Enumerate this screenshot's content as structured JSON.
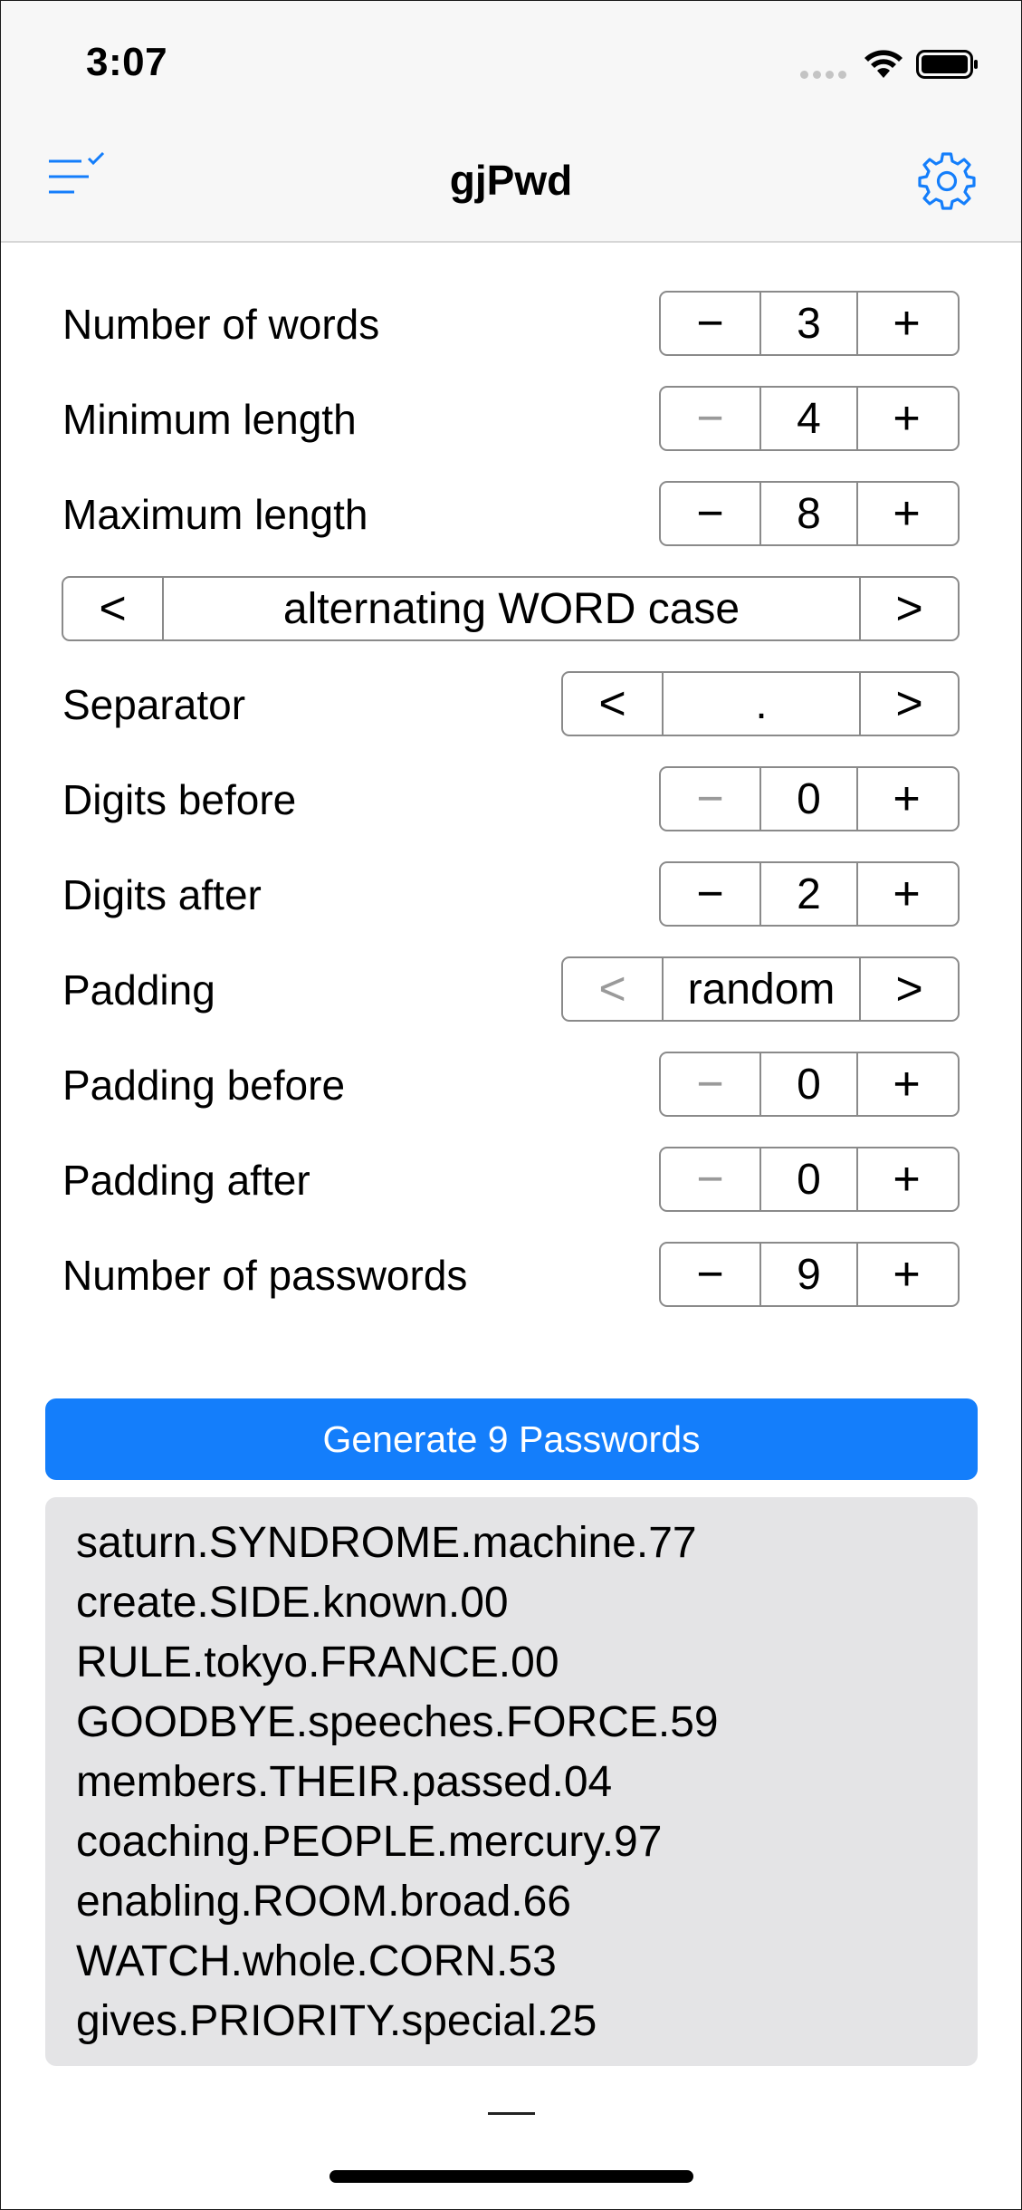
{
  "status_bar": {
    "time": "3:07"
  },
  "nav": {
    "title": "gjPwd",
    "left_icon": "list-check-icon",
    "right_icon": "gear-icon"
  },
  "settings": {
    "number_of_words": {
      "label": "Number of words",
      "value": "3",
      "minus": "−",
      "plus": "+"
    },
    "minimum_length": {
      "label": "Minimum length",
      "value": "4",
      "minus": "−",
      "plus": "+"
    },
    "maximum_length": {
      "label": "Maximum length",
      "value": "8",
      "minus": "−",
      "plus": "+"
    },
    "case_style": {
      "prev": "<",
      "value": "alternating WORD case",
      "next": ">"
    },
    "separator": {
      "label": "Separator",
      "prev": "<",
      "value": ".",
      "next": ">"
    },
    "digits_before": {
      "label": "Digits before",
      "value": "0",
      "minus": "−",
      "plus": "+"
    },
    "digits_after": {
      "label": "Digits after",
      "value": "2",
      "minus": "−",
      "plus": "+"
    },
    "padding": {
      "label": "Padding",
      "prev": "<",
      "value": "random",
      "next": ">"
    },
    "padding_before": {
      "label": "Padding before",
      "value": "0",
      "minus": "−",
      "plus": "+"
    },
    "padding_after": {
      "label": "Padding after",
      "value": "0",
      "minus": "−",
      "plus": "+"
    },
    "number_of_passwords": {
      "label": "Number of passwords",
      "value": "9",
      "minus": "−",
      "plus": "+"
    }
  },
  "generate_button": {
    "label": "Generate 9 Passwords"
  },
  "passwords": [
    "saturn.SYNDROME.machine.77",
    "create.SIDE.known.00",
    "RULE.tokyo.FRANCE.00",
    "GOODBYE.speeches.FORCE.59",
    "members.THEIR.passed.04",
    "coaching.PEOPLE.mercury.97",
    "enabling.ROOM.broad.66",
    "WATCH.whole.CORN.53",
    "gives.PRIORITY.special.25"
  ],
  "colors": {
    "accent": "#147efb",
    "results_bg": "#e4e4e6",
    "disabled": "#9a9a9a"
  }
}
